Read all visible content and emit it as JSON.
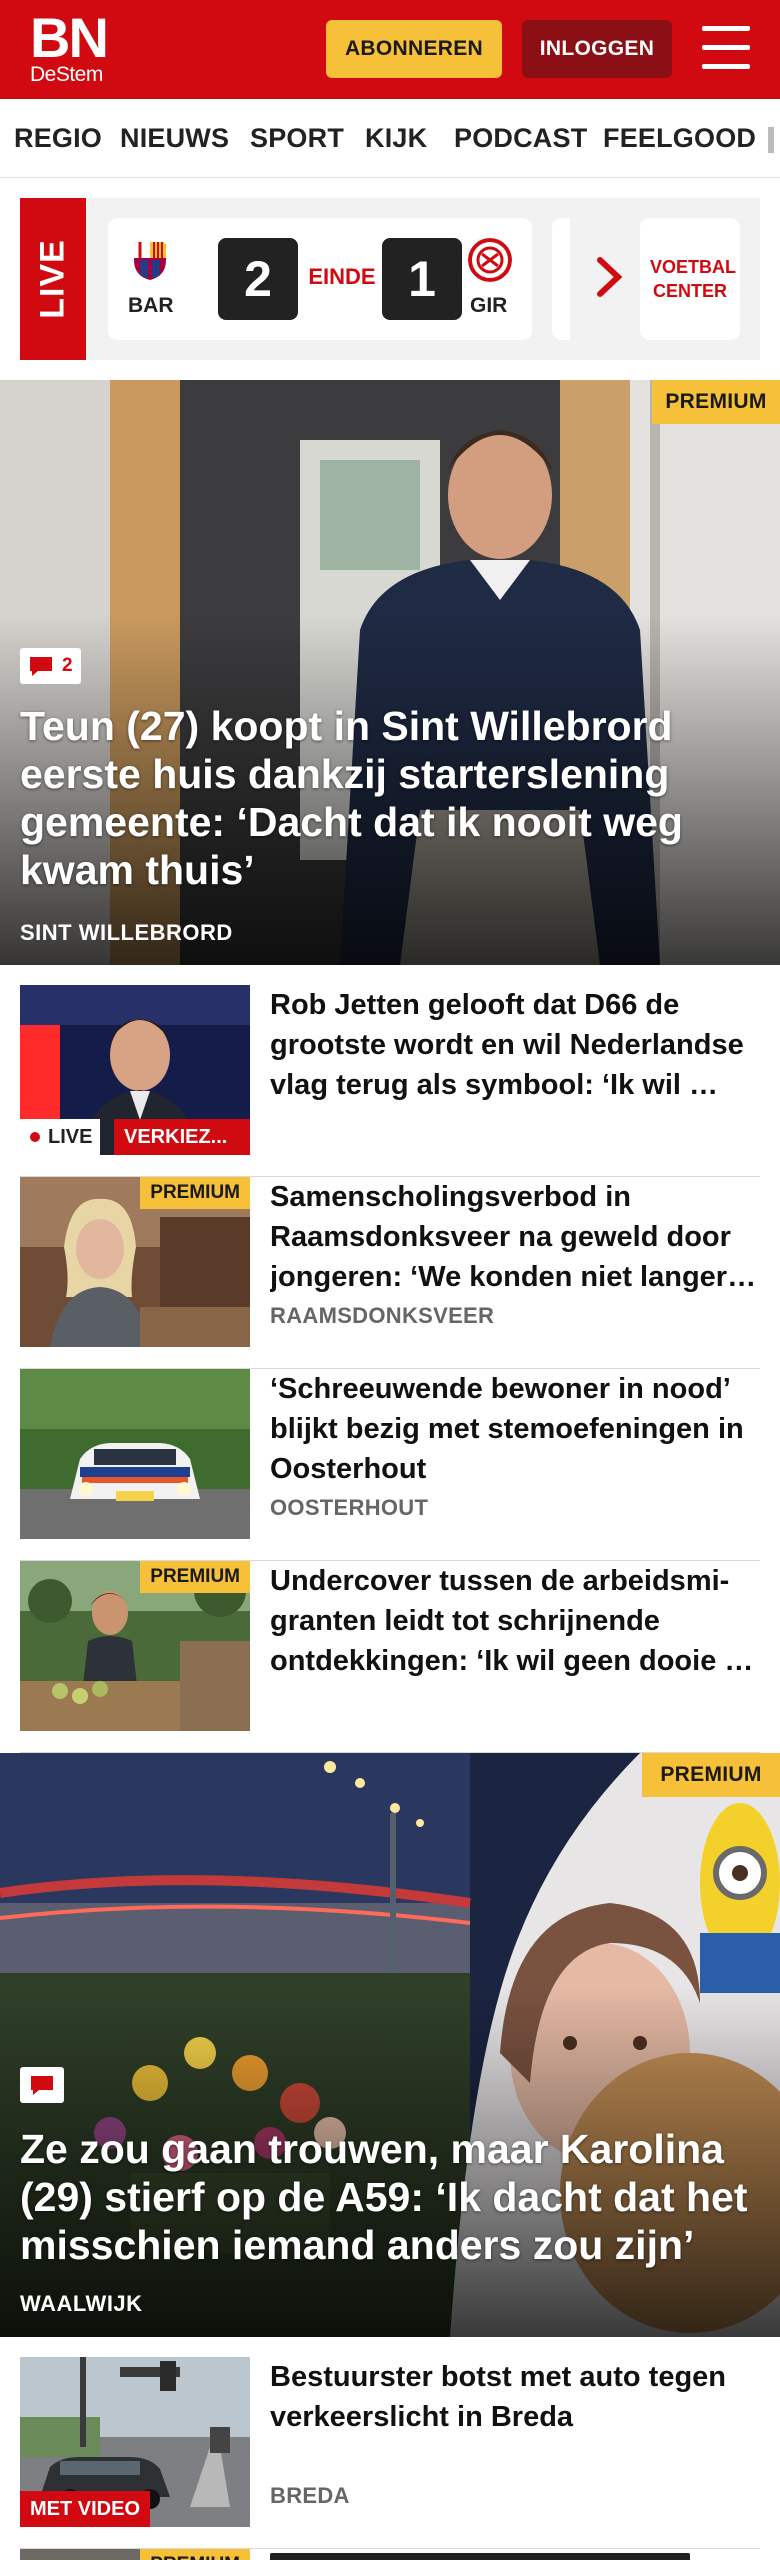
{
  "header": {
    "logo_main": "BN",
    "logo_sub": "DeStem",
    "subscribe_label": "ABONNEREN",
    "login_label": "INLOGGEN"
  },
  "nav": {
    "items": [
      "REGIO",
      "NIEUWS",
      "SPORT",
      "KIJK",
      "PODCAST",
      "FEELGOOD"
    ]
  },
  "live": {
    "label": "LIVE",
    "match": {
      "home": "BAR",
      "home_score": "2",
      "status": "EINDE",
      "away_score": "1",
      "away": "GIR"
    },
    "center_label": "VOETBAL CENTER"
  },
  "hero1": {
    "premium": "PREMIUM",
    "comments": "2",
    "title": "Teun (27) koopt in Sint Willebrord eerste huis dankzij starterslening gemeente: ‘Dacht dat ik nooit weg kwam thuis’",
    "location": "SINT WILLEBRORD"
  },
  "articles": [
    {
      "title": "Rob Jetten gelooft dat D66 de grootste wordt en wil Nederland­se vlag terug als symbool: ‘Ik wil …",
      "live": "LIVE",
      "tag": "VERKIEZ..."
    },
    {
      "title": "Samenscholingsverbod in Raamsdonksveer na geweld door jongeren: ‘We konden niet langer …",
      "premium": "PREMIUM",
      "location": "RAAMSDONKSVEER"
    },
    {
      "title": "‘Schreeuwende bewoner in nood’ blijkt bezig met stemoefeningen in Oosterhout",
      "location": "OOSTERHOUT"
    },
    {
      "title": "Undercover tussen de arbeidsmi­granten leidt tot schrijnende ontdekkingen: ‘Ik wil geen dooie …",
      "premium": "PREMIUM"
    }
  ],
  "hero2": {
    "premium": "PREMIUM",
    "title": "Ze zou gaan trouwen, maar Karolina (29) stierf op de A59: ‘Ik dacht dat het misschien iemand anders zou zijn’",
    "location": "WAALWIJK"
  },
  "article_bottom": {
    "title": "Bestuurster botst met auto tegen verkeerslicht in Breda",
    "video": "MET VIDEO",
    "location": "BREDA"
  },
  "article_cut": {
    "premium": "PREMIUM"
  },
  "colors": {
    "brand_red": "#d10a11",
    "dark_red": "#8b0f14",
    "premium_yellow": "#f6c038"
  }
}
